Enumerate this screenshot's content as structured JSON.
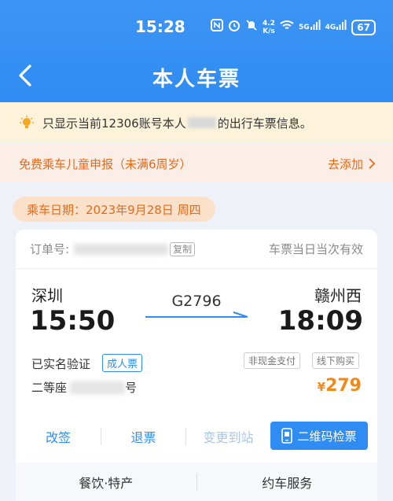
{
  "status_bar": {
    "time": "15:28",
    "icons": [
      "nfc-icon",
      "alarm-icon",
      "mute-icon"
    ],
    "net_speed_value": "4.2",
    "net_speed_unit": "K/s",
    "wifi": "wifi-icon",
    "signal1_label": "5G",
    "signal2_label": "4G",
    "battery": "67"
  },
  "header": {
    "title": "本人车票",
    "back_icon": "chevron-left-icon"
  },
  "notice": {
    "text_prefix": "只显示当前12306账号本人",
    "text_suffix": "的出行车票信息。",
    "icon": "lightbulb-icon"
  },
  "child_declare": {
    "label": "免费乘车儿童申报（未满6周岁）",
    "action": "去添加",
    "icon": "chevron-right-icon"
  },
  "travel_date": {
    "label": "乘车日期：2023年9月28日 周四"
  },
  "ticket": {
    "order_label": "订单号:",
    "copy_label": "复制",
    "validity": "车票当日当次有效",
    "from_station": "深圳",
    "from_time": "15:50",
    "train_no": "G2796",
    "to_station": "赣州西",
    "to_time": "18:09",
    "verify_status": "已实名验证",
    "ticket_type": "成人票",
    "pay_tag": "非现金支付",
    "buy_tag": "线下购买",
    "seat_class": "二等座",
    "seat_suffix": "号",
    "price_symbol": "¥",
    "price": "279"
  },
  "actions": {
    "change": "改签",
    "refund": "退票",
    "change_station": "变更到站",
    "qr_check": "二维码检票"
  },
  "services": {
    "food": "餐饮·特产",
    "car": "约车服务"
  },
  "colors": {
    "primary": "#2f8cf2",
    "orange": "#e86a1a",
    "price": "#f08a1c",
    "notice_bg": "#fdf3da"
  }
}
